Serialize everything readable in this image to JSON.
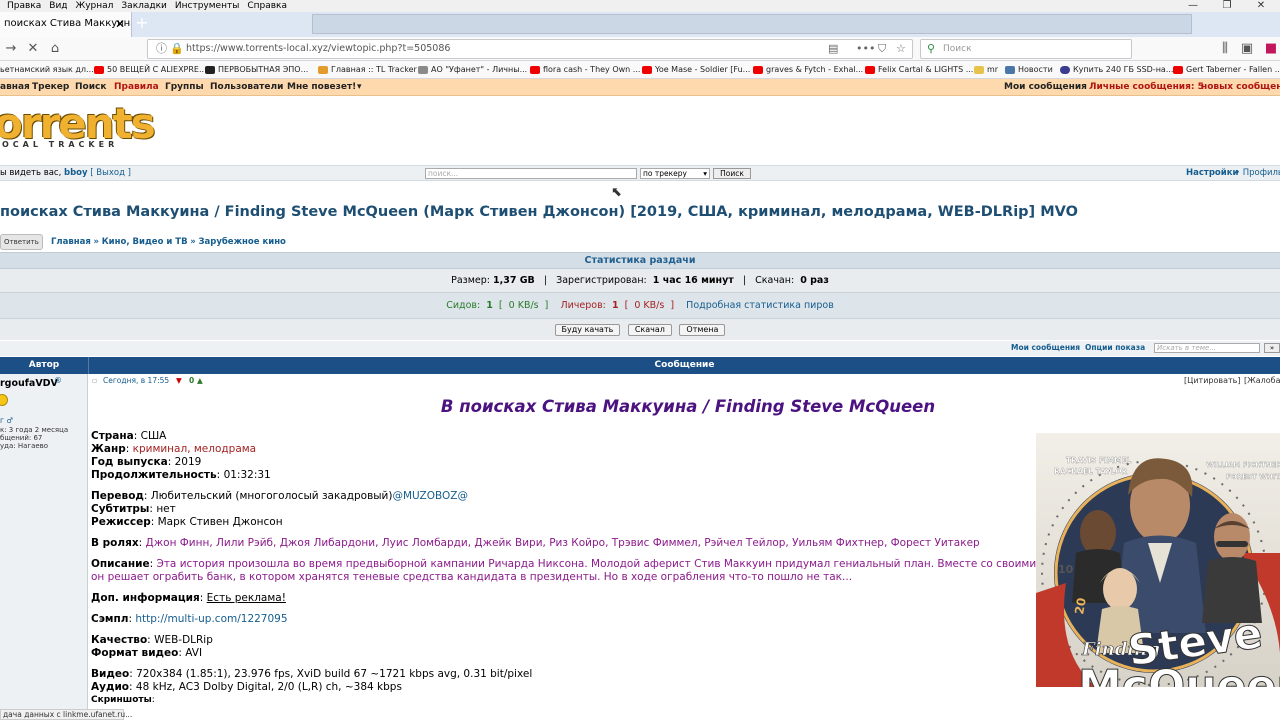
{
  "browser": {
    "menu": [
      "Правка",
      "Вид",
      "Журнал",
      "Закладки",
      "Инструменты",
      "Справка"
    ],
    "tab_title": "поисках Стива Маккуина / F",
    "url": "https://www.torrents-local.xyz/viewtopic.php?t=505086",
    "search_placeholder": "Поиск",
    "bookmarks": [
      "ьетнамский язык дл...",
      "50 ВЕЩЕЙ С ALIEXPRE...",
      "ПЕРВОБЫТНАЯ ЭПО...",
      "Главная :: TL Tracker",
      "АО \"Уфанет\" - Личны...",
      "flora cash - They Own ...",
      "Yoe Mase - Soldier [Fu...",
      "graves & Fytch - Exhal...",
      "Felix Cartal & LIGHTS ...",
      "mr",
      "Новости",
      "Купить 240 ГБ SSD-на...",
      "Gert Taberner - Fallen ..."
    ],
    "status_text": "дача данных с linkme.ufanet.ru..."
  },
  "site": {
    "nav": [
      "авная",
      "Трекер",
      "Поиск",
      "Правила",
      "Группы",
      "Пользователи",
      "Мне повезет!"
    ],
    "nav_right_messages": "Мои сообщения",
    "nav_right_pm_label": "Личные сообщения: 5",
    "nav_right_pm_new": "новых сообщени",
    "logo_text": "orrents",
    "logo_sub": "OCAL TRACKER",
    "greeting_prefix": "ы видеть вас,",
    "username": "bboy",
    "logout": "[ Выход ]",
    "search_placeholder": "поиск...",
    "search_scope": "по трекеру",
    "search_button": "Поиск",
    "settings": "Настройки",
    "profile": "Профиль"
  },
  "topic": {
    "title": "поисках Стива Маккуина / Finding Steve McQueen (Марк Стивен Джонсон) [2019, США, криминал, мелодрама, WEB-DLRip] MVO",
    "reply_button": "Ответить",
    "breadcrumb": [
      "Главная",
      "Кино, Видео и ТВ",
      "Зарубежное кино"
    ],
    "stats_title": "Статистика раздачи",
    "size_label": "Размер:",
    "size_value": "1,37 GB",
    "registered_label": "Зарегистрирован:",
    "registered_value": "1 час 16 минут",
    "downloads_label": "Скачан:",
    "downloads_value": "0 раз",
    "seeds_label": "Сидов:",
    "seeds_value": "1",
    "seeds_speed": "0 KB/s",
    "leech_label": "Личеров:",
    "leech_value": "1",
    "leech_speed": "0 KB/s",
    "peers_link": "Подробная статистика пиров",
    "btn_will_download": "Буду качать",
    "btn_download": "Скачал",
    "btn_cancel": "Отмена"
  },
  "postbar": {
    "my_messages": "Мои сообщения",
    "display_options": "Опции показа",
    "search_placeholder": "Искать в теме...",
    "go": "»"
  },
  "post": {
    "author_header": "Автор",
    "message_header": "Сообщение",
    "author_name": "rgoufaVDV",
    "author_stats": [
      "к: 3 года 2 месяца",
      "бщений: 67",
      "уда: Нагаево"
    ],
    "post_time": "Сегодня, в 17:55",
    "rating": "0",
    "quote": "[Цитировать]",
    "complain": "[Жалоба",
    "heading": "В поисках Стива Маккуина / Finding Steve McQueen",
    "country_l": "Страна",
    "country_v": "США",
    "genre_l": "Жанр",
    "genre_v": "криминал, мелодрама",
    "year_l": "Год выпуска",
    "year_v": "2019",
    "duration_l": "Продолжительность",
    "duration_v": "01:32:31",
    "translation_l": "Перевод",
    "translation_v": "Любительский (многоголосый закадровый)",
    "translation_link": "@MUZOBOZ@",
    "subs_l": "Субтитры",
    "subs_v": "нет",
    "director_l": "Режиссер",
    "director_v": "Марк Стивен Джонсон",
    "cast_l": "В ролях",
    "cast_v": "Джон Финн, Лили Рэйб, Джоя Либардони, Луис Ломбарди, Джейк Вири, Риз Койро, Трэвис Фиммел, Рэйчел Тейлор, Уильям Фихтнер, Форест Уитакер",
    "desc_l": "Описание",
    "desc_line1": "Эта история произошла во время предвыборной кампании Ричарда Никсона. Молодой аферист Стив Маккуин придумал гениальный план. Вместе со своими сообщниками",
    "desc_line2": "он решает ограбить банк, в котором хранятся теневые средства кандидата в президенты. Но в ходе ограбления что-то пошло не так...",
    "extra_l": "Доп. информация",
    "extra_v": "Есть реклама!",
    "sample_l": "Сэмпл",
    "sample_v": "http://multi-up.com/1227095",
    "quality_l": "Качество",
    "quality_v": "WEB-DLRip",
    "format_l": "Формат видео",
    "format_v": "AVI",
    "video_l": "Видео",
    "video_v": "720x384 (1.85:1), 23.976 fps, XviD build 67 ~1721 kbps avg, 0.31 bit/pixel",
    "audio_l": "Аудио",
    "audio_v": "48 kHz, AC3 Dolby Digital, 2/0 (L,R) ch, ~384 kbps",
    "screens_l": "Скриншоты",
    "poster": {
      "cast_left": [
        "TRAVIS FIMMEL",
        "RACHAEL TAYLOR"
      ],
      "cast_right": [
        "WILLIAM FICHTNER",
        "FOREST WHITAKER"
      ],
      "title_small": "Finding",
      "title_big1": "Steve",
      "title_big2": "McQueen",
      "dial": [
        "10",
        "20"
      ]
    }
  }
}
